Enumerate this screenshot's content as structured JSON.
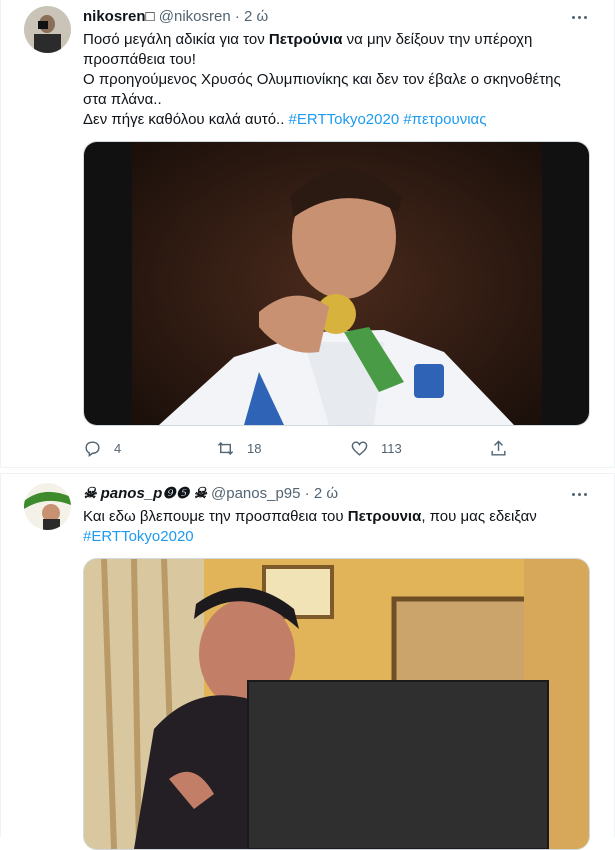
{
  "tweets": [
    {
      "display_name": "nikosren□",
      "handle": "@nikosren",
      "dot": "·",
      "time": "2 ώ",
      "lines": [
        [
          "Ποσό μεγάλη αδικία για τον ",
          "Πετρούνια",
          " να μην δείξουν την υπέροχη"
        ],
        [
          "προσπάθεια του!"
        ],
        [
          "Ο προηγούμενος Χρυσός Ολυμπιονίκης και δεν τον έβαλε ο σκηνοθέτης"
        ],
        [
          "στα πλάνα.."
        ],
        [
          "Δεν πήγε καθόλου καλά αυτό.. "
        ]
      ],
      "tags": [
        "#ERTTokyo2020",
        "#πετρουνιας"
      ],
      "replies": "4",
      "retweets": "18",
      "likes": "113"
    },
    {
      "display_name": "☠ panos_p",
      "name_badges": "❾❺",
      "name_suffix": " ☠",
      "handle": "@panos_p95",
      "dot": "·",
      "time": "2 ώ",
      "line1_pre": "Και εδω βλεπουμε την προσπαθεια του ",
      "line1_bold": "Πετρουνια",
      "line1_post": ", που μας εδειξαν",
      "tag": "#ERTTokyo2020"
    }
  ],
  "colors": {
    "link": "#1d9bf0",
    "muted": "#536471",
    "border": "#eff3f4"
  },
  "icons": [
    "reply-icon",
    "retweet-icon",
    "like-icon",
    "share-icon",
    "more-icon"
  ]
}
